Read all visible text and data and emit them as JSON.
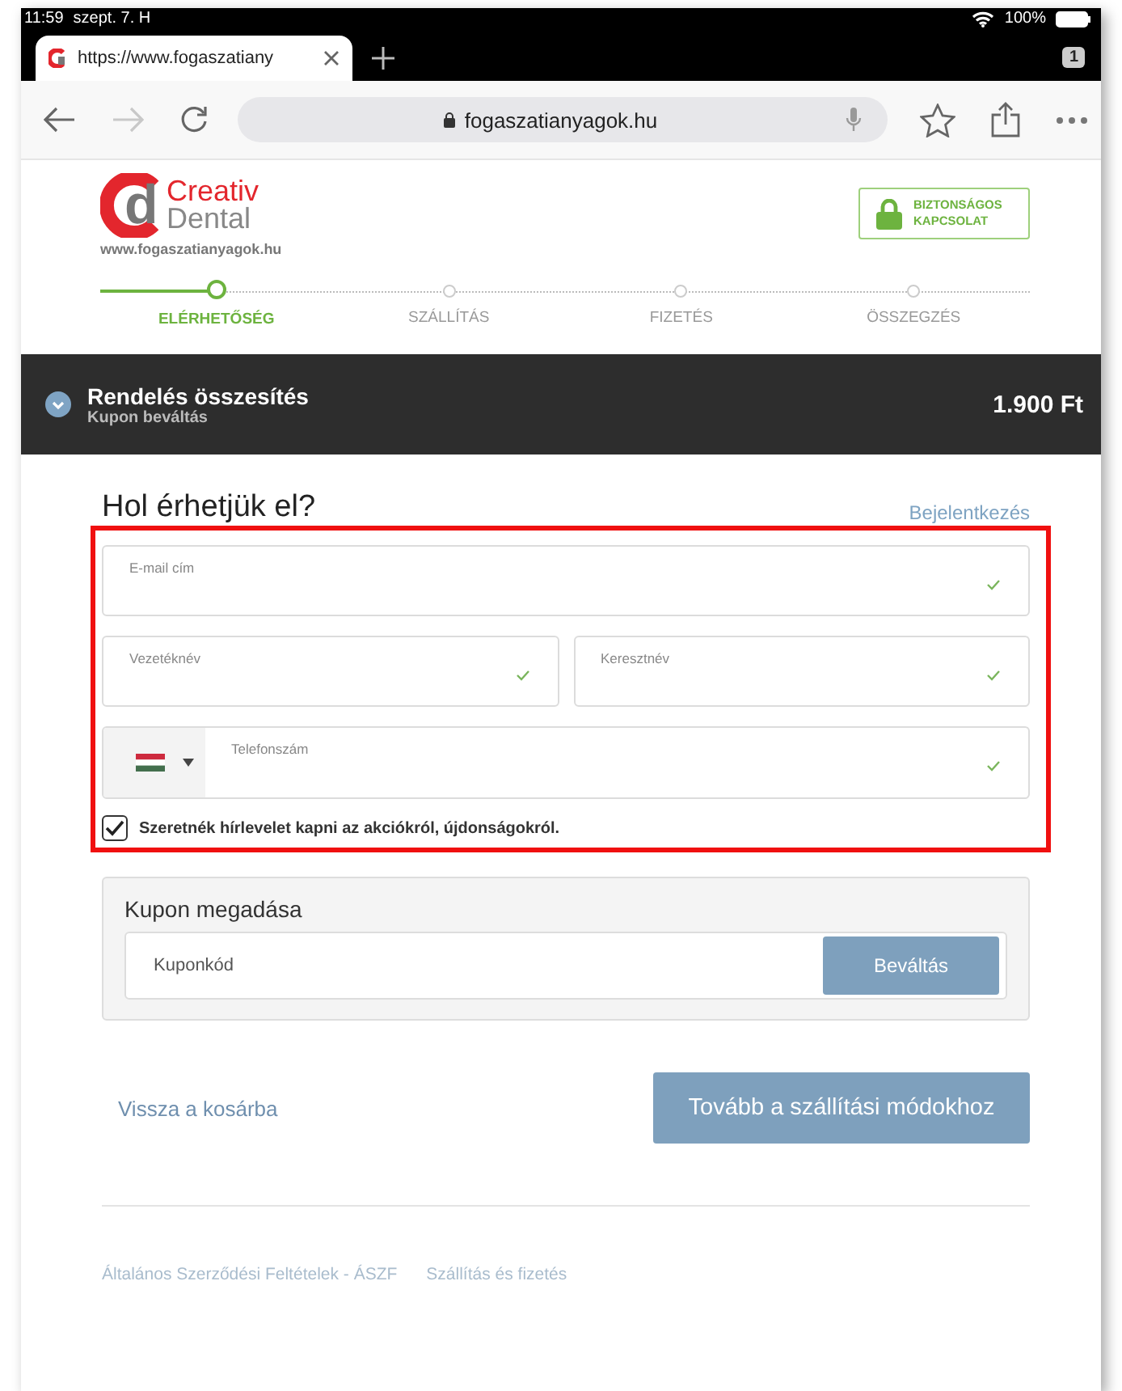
{
  "status_bar": {
    "time": "11:59",
    "date": "szept. 7. H",
    "battery": "100%"
  },
  "browser": {
    "tabs": [
      {
        "title": "https://www.fogaszatiany",
        "selected": true
      }
    ],
    "tab_count": "1",
    "address": "fogaszatianyagok.hu",
    "forward_disabled": true
  },
  "header": {
    "logo": {
      "mark": "d",
      "line1": "Creativ",
      "line2": "Dental",
      "url": "www.fogaszatianyagok.hu"
    },
    "secure_badge": [
      "BIZTONSÁGOS",
      "KAPCSOLAT"
    ]
  },
  "steps": [
    {
      "label": "ELÉRHETŐSÉG",
      "selected": true
    },
    {
      "label": "SZÁLLÍTÁS",
      "selected": false
    },
    {
      "label": "FIZETÉS",
      "selected": false
    },
    {
      "label": "ÖSSZEGZÉS",
      "selected": false
    }
  ],
  "order_summary": {
    "title": "Rendelés összesítés",
    "subtitle": "Kupon beváltás",
    "total": "1.900 Ft"
  },
  "form": {
    "heading": "Hol érhetjük el?",
    "login_link": "Bejelentkezés",
    "rows": [
      [
        {
          "kind": "text",
          "label": "E-mail cím",
          "valid": true
        }
      ],
      [
        {
          "kind": "text",
          "label": "Vezetéknév",
          "valid": true
        },
        {
          "kind": "text",
          "label": "Keresztnév",
          "valid": true
        }
      ],
      [
        {
          "kind": "phone",
          "label": "Telefonszám",
          "valid": true
        }
      ]
    ],
    "newsletter": {
      "label": "Szeretnék hírlevelet kapni az akciókról, újdonságokról.",
      "checked": true
    }
  },
  "coupon": {
    "title": "Kupon megadása",
    "placeholder": "Kuponkód",
    "button": "Beváltás"
  },
  "actions": {
    "back_link": "Vissza a kosárba",
    "continue_button": "Tovább a szállítási módokhoz"
  },
  "footer_links": [
    "Általános Szerződési Feltételek - ÁSZF",
    "Szállítás és fizetés"
  ]
}
